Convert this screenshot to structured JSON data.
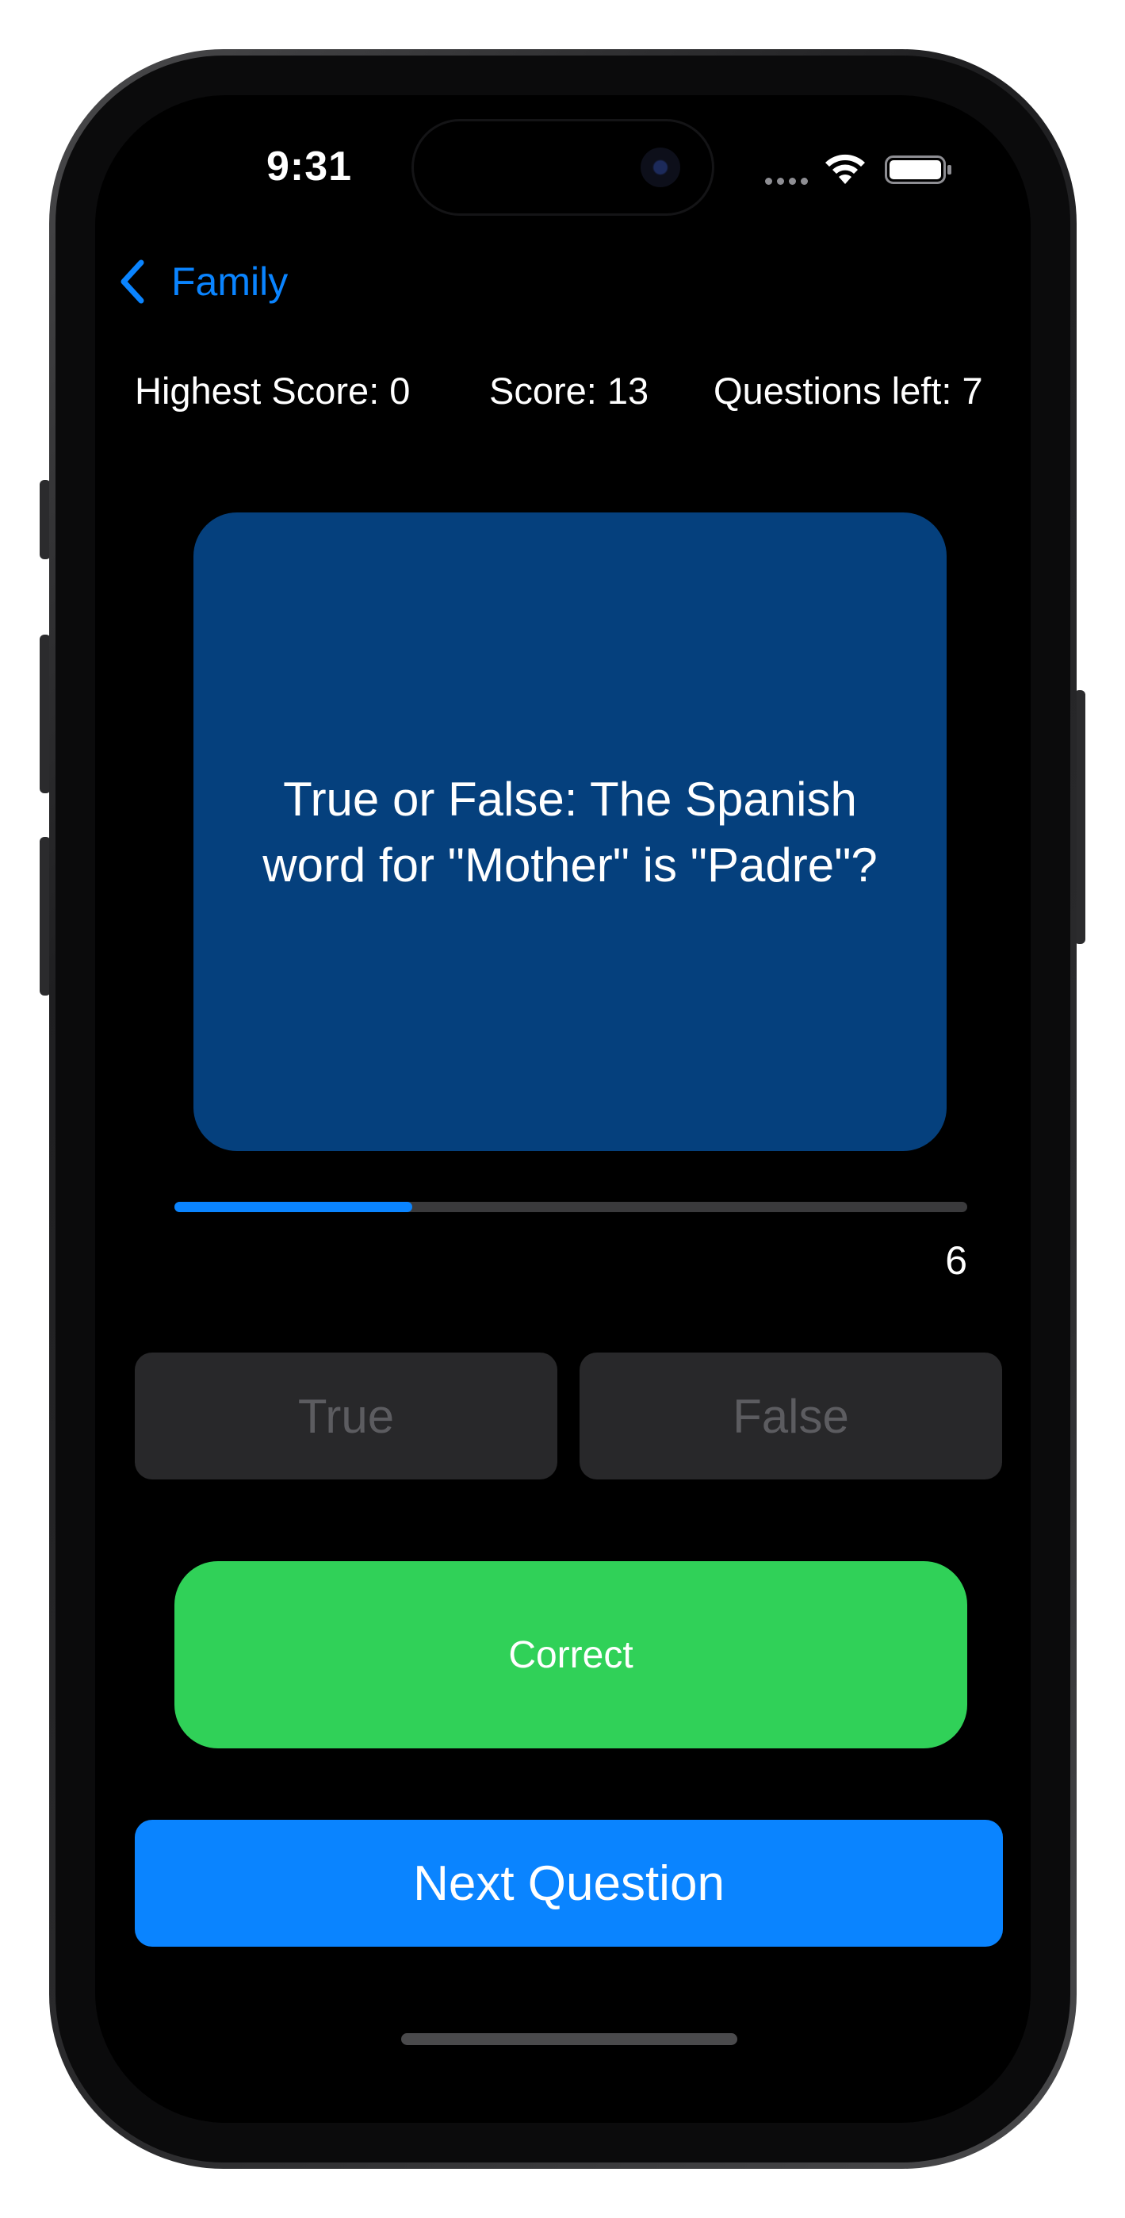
{
  "status_bar": {
    "time": "9:31",
    "icons": [
      "signal-dots-icon",
      "wifi-icon",
      "battery-icon"
    ]
  },
  "nav": {
    "back_label": "Family",
    "back_icon": "chevron-left-icon"
  },
  "scores": {
    "highest": "Highest Score: 0",
    "score": "Score: 13",
    "questions_left": "Questions left: 7"
  },
  "question": {
    "text": "True or False: The Spanish word for \"Mother\" is \"Padre\"?"
  },
  "timer": {
    "value": "6",
    "progress_fraction": 0.3
  },
  "answers": {
    "true_label": "True",
    "false_label": "False"
  },
  "result": {
    "label": "Correct"
  },
  "next_button": {
    "label": "Next Question"
  },
  "colors": {
    "accent": "#0a84ff",
    "card": "#05407d",
    "correct": "#30d158",
    "disabled_button": "#28282a"
  }
}
